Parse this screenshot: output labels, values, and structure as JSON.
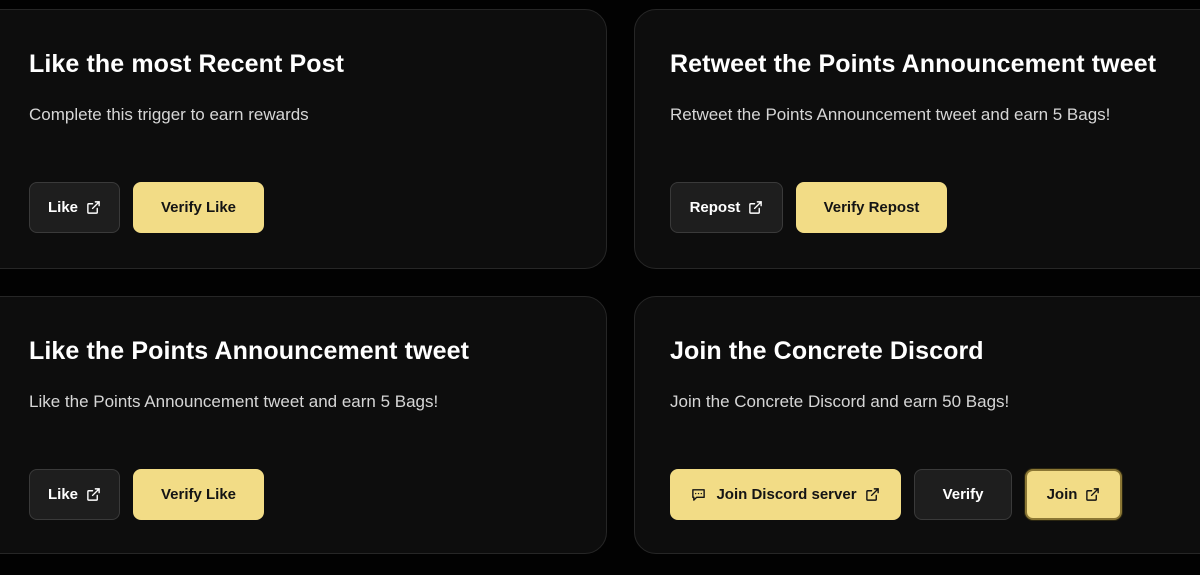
{
  "colors": {
    "background": "#020202",
    "card": "#0d0d0d",
    "accent": "#f2dc86",
    "dark_button": "#1e1e1e"
  },
  "cards": [
    {
      "title": "Like the most Recent Post",
      "description": "Complete this trigger to earn rewards",
      "action_label": "Like",
      "action_icon": "external-link-icon",
      "verify_label": "Verify Like"
    },
    {
      "title": "Retweet the Points Announcement tweet",
      "description": "Retweet the Points Announcement tweet and earn 5 Bags!",
      "action_label": "Repost",
      "action_icon": "external-link-icon",
      "verify_label": "Verify Repost"
    },
    {
      "title": "Like the Points Announcement tweet",
      "description": "Like the Points Announcement tweet and earn 5 Bags!",
      "action_label": "Like",
      "action_icon": "external-link-icon",
      "verify_label": "Verify Like"
    },
    {
      "title": "Join the Concrete Discord",
      "description": "Join the Concrete Discord and earn 50 Bags!",
      "discord_label": "Join Discord server",
      "discord_icon": "chat-icon",
      "verify_label": "Verify",
      "join_label": "Join",
      "join_icon": "external-link-icon"
    }
  ]
}
